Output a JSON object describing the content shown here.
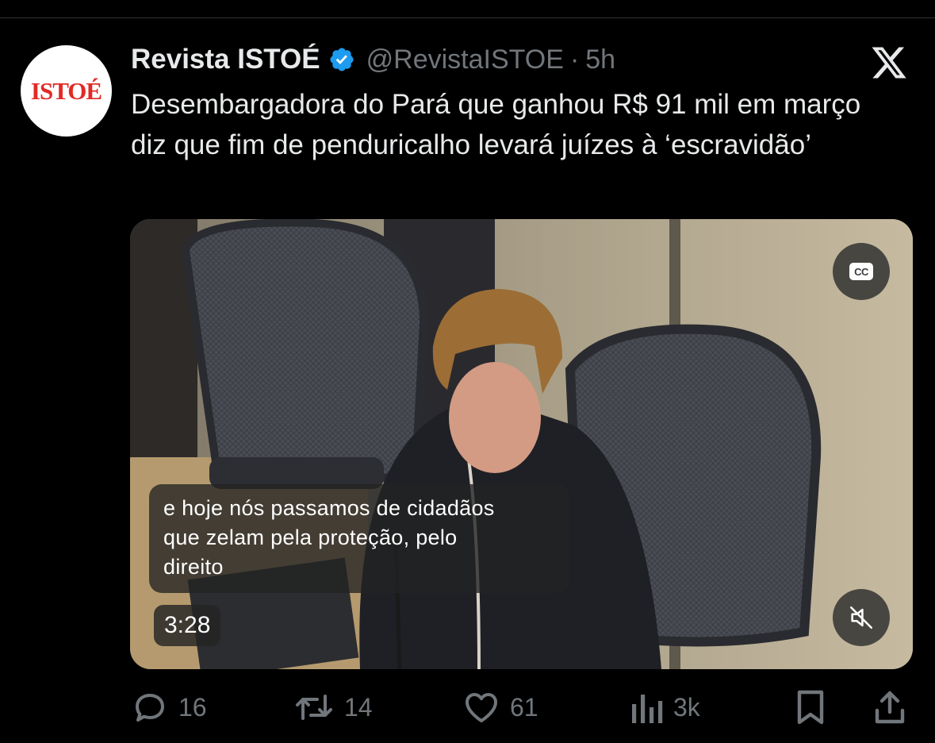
{
  "tweet": {
    "author_name": "Revista ISTOÉ",
    "handle": "@RevistaISTOE",
    "separator": "·",
    "time": "5h",
    "avatar_text": "ISTOÉ",
    "text": "Desembargadora do Pará que ganhou R$ 91 mil em março diz que fim de penduricalho levará juízes à ‘escravidão’"
  },
  "media": {
    "cc_label": "CC",
    "caption_lines": [
      "e hoje nós passamos de cidadãos",
      "que zelam pela proteção, pelo",
      "direito"
    ],
    "duration": "3:28"
  },
  "actions": {
    "reply_count": "16",
    "repost_count": "14",
    "like_count": "61",
    "views_count": "3k"
  },
  "icons": {
    "verified": "verified-badge-icon",
    "platform": "x-logo-icon",
    "cc": "closed-captions-icon",
    "mute": "muted-speaker-icon",
    "reply": "reply-icon",
    "repost": "repost-icon",
    "like": "heart-icon",
    "views": "views-icon",
    "bookmark": "bookmark-icon",
    "share": "share-icon"
  },
  "colors": {
    "background": "#000000",
    "text_primary": "#e7e9ea",
    "text_secondary": "#71767b",
    "verified_blue": "#1d9bf0",
    "brand_red": "#e22a25"
  }
}
